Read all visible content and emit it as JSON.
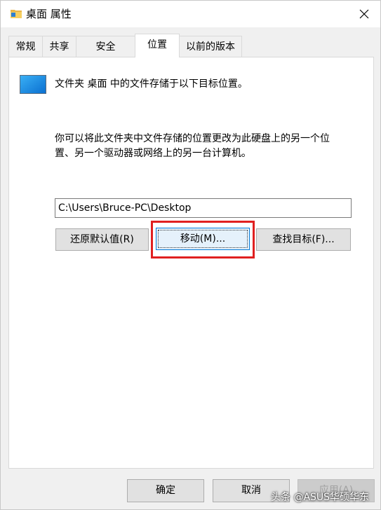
{
  "window": {
    "title": "桌面 属性"
  },
  "tabs": [
    {
      "label": "常规"
    },
    {
      "label": "共享"
    },
    {
      "label": "安全"
    },
    {
      "label": "位置",
      "active": true
    },
    {
      "label": "以前的版本"
    }
  ],
  "location": {
    "intro": "文件夹 桌面 中的文件存储于以下目标位置。",
    "description_line1": "你可以将此文件夹中文件存储的位置更改为此硬盘上的另一个位",
    "description_line2": "置、另一个驱动器或网络上的另一台计算机。",
    "path_value": "C:\\Users\\Bruce-PC\\Desktop",
    "restore_default_label": "还原默认值(R)",
    "move_label": "移动(M)...",
    "find_target_label": "查找目标(F)..."
  },
  "footer": {
    "ok_label": "确定",
    "cancel_label": "取消",
    "apply_label": "应用(A)"
  },
  "watermark": {
    "text": "头条 @ASUS华硕华东"
  },
  "colors": {
    "highlight": "#e02020",
    "accent": "#0078d7"
  },
  "icons": {
    "folder": "folder-icon",
    "monitor": "desktop-monitor-icon",
    "close": "close-icon"
  }
}
